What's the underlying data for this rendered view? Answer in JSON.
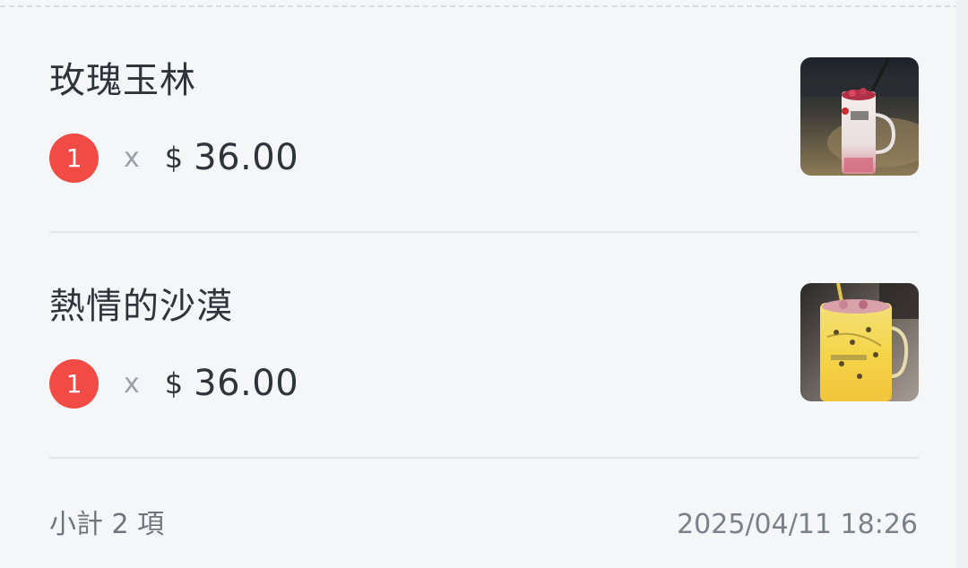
{
  "items": [
    {
      "name": "玫瑰玉林",
      "quantity": "1",
      "times": "x",
      "currency": "$",
      "price": "36.00",
      "image": "rose-drink-photo"
    },
    {
      "name": "熱情的沙漠",
      "quantity": "1",
      "times": "x",
      "currency": "$",
      "price": "36.00",
      "image": "passionfruit-drink-photo"
    }
  ],
  "footer": {
    "count_text": "小計 2 項",
    "timestamp": "2025/04/11 18:26"
  },
  "colors": {
    "badge": "#f24a45",
    "background": "#f5f6f8",
    "divider": "#e1e4e8"
  }
}
